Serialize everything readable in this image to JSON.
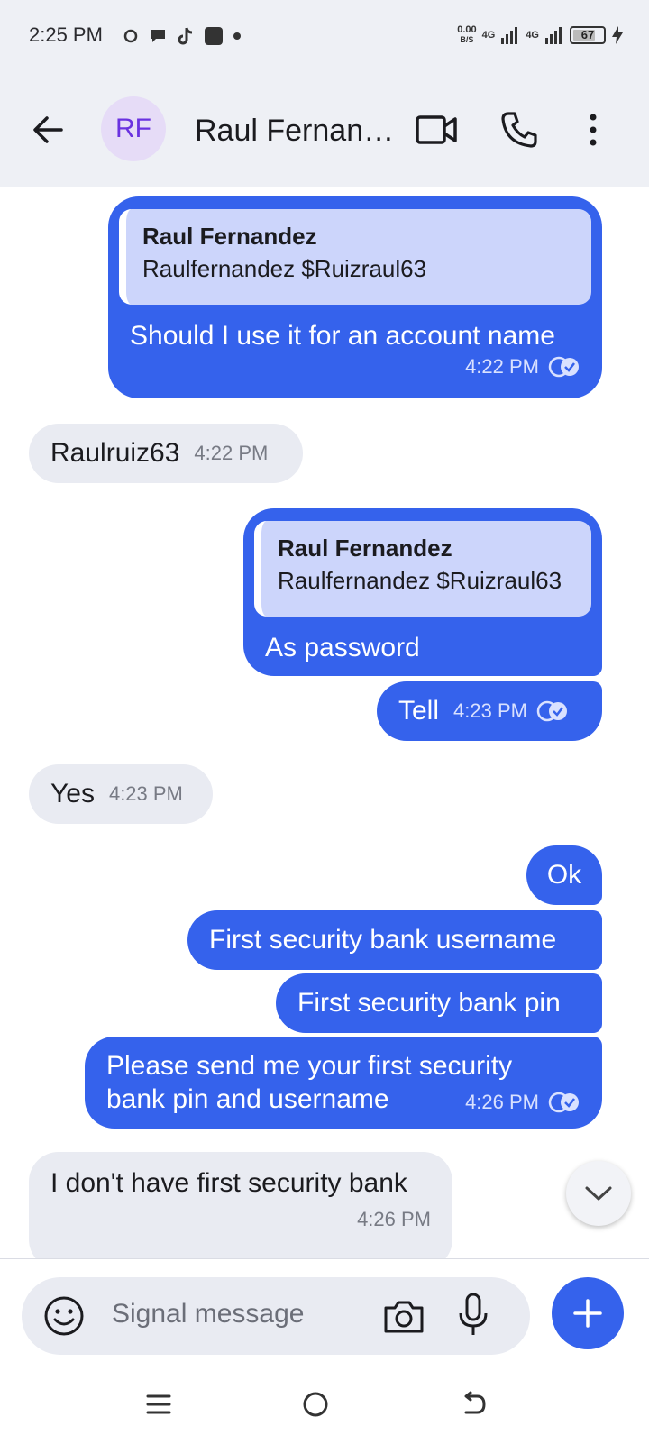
{
  "status_bar": {
    "time": "2:25 PM",
    "net_speed_value": "0.00",
    "net_speed_unit": "B/S",
    "signal_1": "4G",
    "signal_2": "4G",
    "battery": "67"
  },
  "header": {
    "avatar_initials": "RF",
    "contact_name": "Raul Fernandez"
  },
  "messages": [
    {
      "direction": "outgoing",
      "quote_author": "Raul Fernandez",
      "quote_text": "Raulfernandez $Ruizraul63",
      "text": "Should I use it for an account name",
      "time": "4:22 PM",
      "status": "read"
    },
    {
      "direction": "incoming",
      "text": "Raulruiz63",
      "time": "4:22 PM"
    },
    {
      "direction": "outgoing",
      "quote_author": "Raul Fernandez",
      "quote_text": "Raulfernandez $Ruizraul63",
      "text": "As password"
    },
    {
      "direction": "outgoing",
      "text": "Tell",
      "time": "4:23 PM",
      "status": "read"
    },
    {
      "direction": "incoming",
      "text": "Yes",
      "time": "4:23 PM"
    },
    {
      "direction": "outgoing",
      "text": "Ok"
    },
    {
      "direction": "outgoing",
      "text": "First security bank username"
    },
    {
      "direction": "outgoing",
      "text": "First security bank pin"
    },
    {
      "direction": "outgoing",
      "text": "Please send me your first security\nbank pin and username",
      "time": "4:26 PM",
      "status": "read"
    },
    {
      "direction": "incoming",
      "text": "I don't have first security bank",
      "time": "4:26 PM"
    }
  ],
  "composer": {
    "placeholder": "Signal message"
  },
  "colors": {
    "outgoing_bubble": "#3562ec",
    "incoming_bubble": "#e9ebf2",
    "quote_background": "#ccd5fb",
    "avatar_background": "#e6dcf7",
    "avatar_text": "#6a32e0"
  }
}
